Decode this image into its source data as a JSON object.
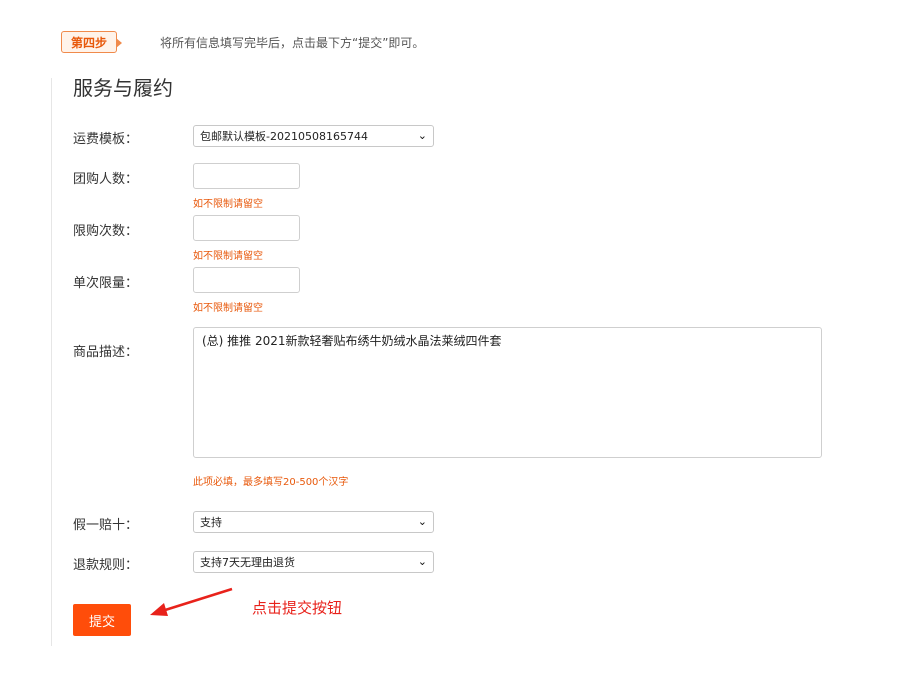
{
  "step": {
    "badge": "第四步",
    "description": "将所有信息填写完毕后，点击最下方“提交”即可。"
  },
  "section_title": "服务与履约",
  "fields": {
    "shipping_template": {
      "label": "运费模板：",
      "value": "包邮默认模板-20210508165744"
    },
    "group_size": {
      "label": "团购人数：",
      "value": "",
      "hint": "如不限制请留空"
    },
    "purchase_limit_times": {
      "label": "限购次数：",
      "value": "",
      "hint": "如不限制请留空"
    },
    "single_limit": {
      "label": "单次限量：",
      "value": "",
      "hint": "如不限制请留空"
    },
    "description": {
      "label": "商品描述：",
      "value": "(总) 推推 2021新款轻奢贴布绣牛奶绒水晶法莱绒四件套",
      "hint": "此项必填，最多填写20-500个汉字"
    },
    "fake_compensation": {
      "label": "假一赔十：",
      "value": "支持"
    },
    "refund_rule": {
      "label": "退款规则：",
      "value": "支持7天无理由退货"
    }
  },
  "submit_label": "提交",
  "annotation": "点击提交按钮",
  "colors": {
    "accent": "#ff4d0a",
    "hint": "#e8590c",
    "annotation": "#e8221b"
  }
}
